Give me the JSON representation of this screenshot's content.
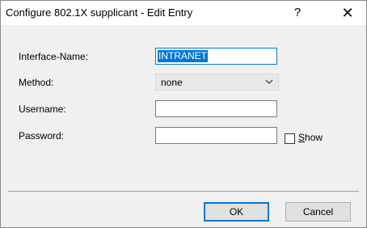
{
  "window": {
    "title": "Configure 802.1X supplicant - Edit Entry",
    "help_glyph": "?",
    "close_glyph": "✕"
  },
  "form": {
    "interface_name": {
      "label": "Interface-Name:",
      "value": "INTRANET"
    },
    "method": {
      "label": "Method:",
      "selected": "none"
    },
    "username": {
      "label": "Username:",
      "value": ""
    },
    "password": {
      "label": "Password:",
      "value": ""
    },
    "show_password": {
      "label": "Show",
      "checked": false
    }
  },
  "buttons": {
    "ok": "OK",
    "cancel": "Cancel"
  },
  "colors": {
    "accent": "#0078d7",
    "dialog_bg": "#f0f0f0"
  }
}
